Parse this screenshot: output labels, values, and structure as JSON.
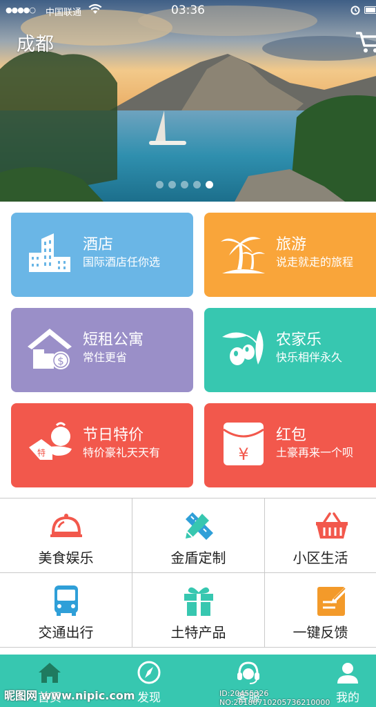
{
  "status_bar": {
    "carrier": "中国联通",
    "time": "03:36"
  },
  "header": {
    "city": "成都"
  },
  "banner": {
    "dot_count": 5,
    "active_dot": 4
  },
  "cards": [
    {
      "title": "酒店",
      "subtitle": "国际酒店任你选",
      "color": "#6ab6e6",
      "icon": "hotel-building-icon"
    },
    {
      "title": "旅游",
      "subtitle": "说走就走的旅程",
      "color": "#f9a53a",
      "icon": "palm-tree-icon"
    },
    {
      "title": "短租公寓",
      "subtitle": "常住更省",
      "color": "#9a8fc8",
      "icon": "house-coin-icon"
    },
    {
      "title": "农家乐",
      "subtitle": "快乐相伴永久",
      "color": "#37c7b0",
      "icon": "olive-fruit-icon"
    },
    {
      "title": "节日特价",
      "subtitle": "特价豪礼天天有",
      "color": "#f2584c",
      "icon": "price-tag-icon"
    },
    {
      "title": "红包",
      "subtitle": "土豪再来一个呗",
      "color": "#f2584c",
      "icon": "red-envelope-icon"
    }
  ],
  "services": [
    {
      "label": "美食娱乐",
      "icon": "food-cloche-icon"
    },
    {
      "label": "金盾定制",
      "icon": "pencil-ruler-icon"
    },
    {
      "label": "小区生活",
      "icon": "shopping-basket-icon"
    },
    {
      "label": "交通出行",
      "icon": "bus-icon"
    },
    {
      "label": "土特产品",
      "icon": "gift-box-icon"
    },
    {
      "label": "一键反馈",
      "icon": "feedback-note-icon"
    }
  ],
  "tabs": [
    {
      "label": "首页",
      "icon": "home-icon",
      "active": true
    },
    {
      "label": "发现",
      "icon": "compass-icon",
      "active": false
    },
    {
      "label": "客服",
      "icon": "headset-icon",
      "active": false
    },
    {
      "label": "我的",
      "icon": "user-icon",
      "active": false
    }
  ],
  "watermark": {
    "site": "昵图网 www.nipic.com",
    "id": "ID:20455326 NO:20180710205736210000"
  },
  "colors": {
    "brand": "#37c7b0",
    "blue": "#6ab6e6",
    "orange": "#f9a53a",
    "purple": "#9a8fc8",
    "red": "#f2584c"
  }
}
